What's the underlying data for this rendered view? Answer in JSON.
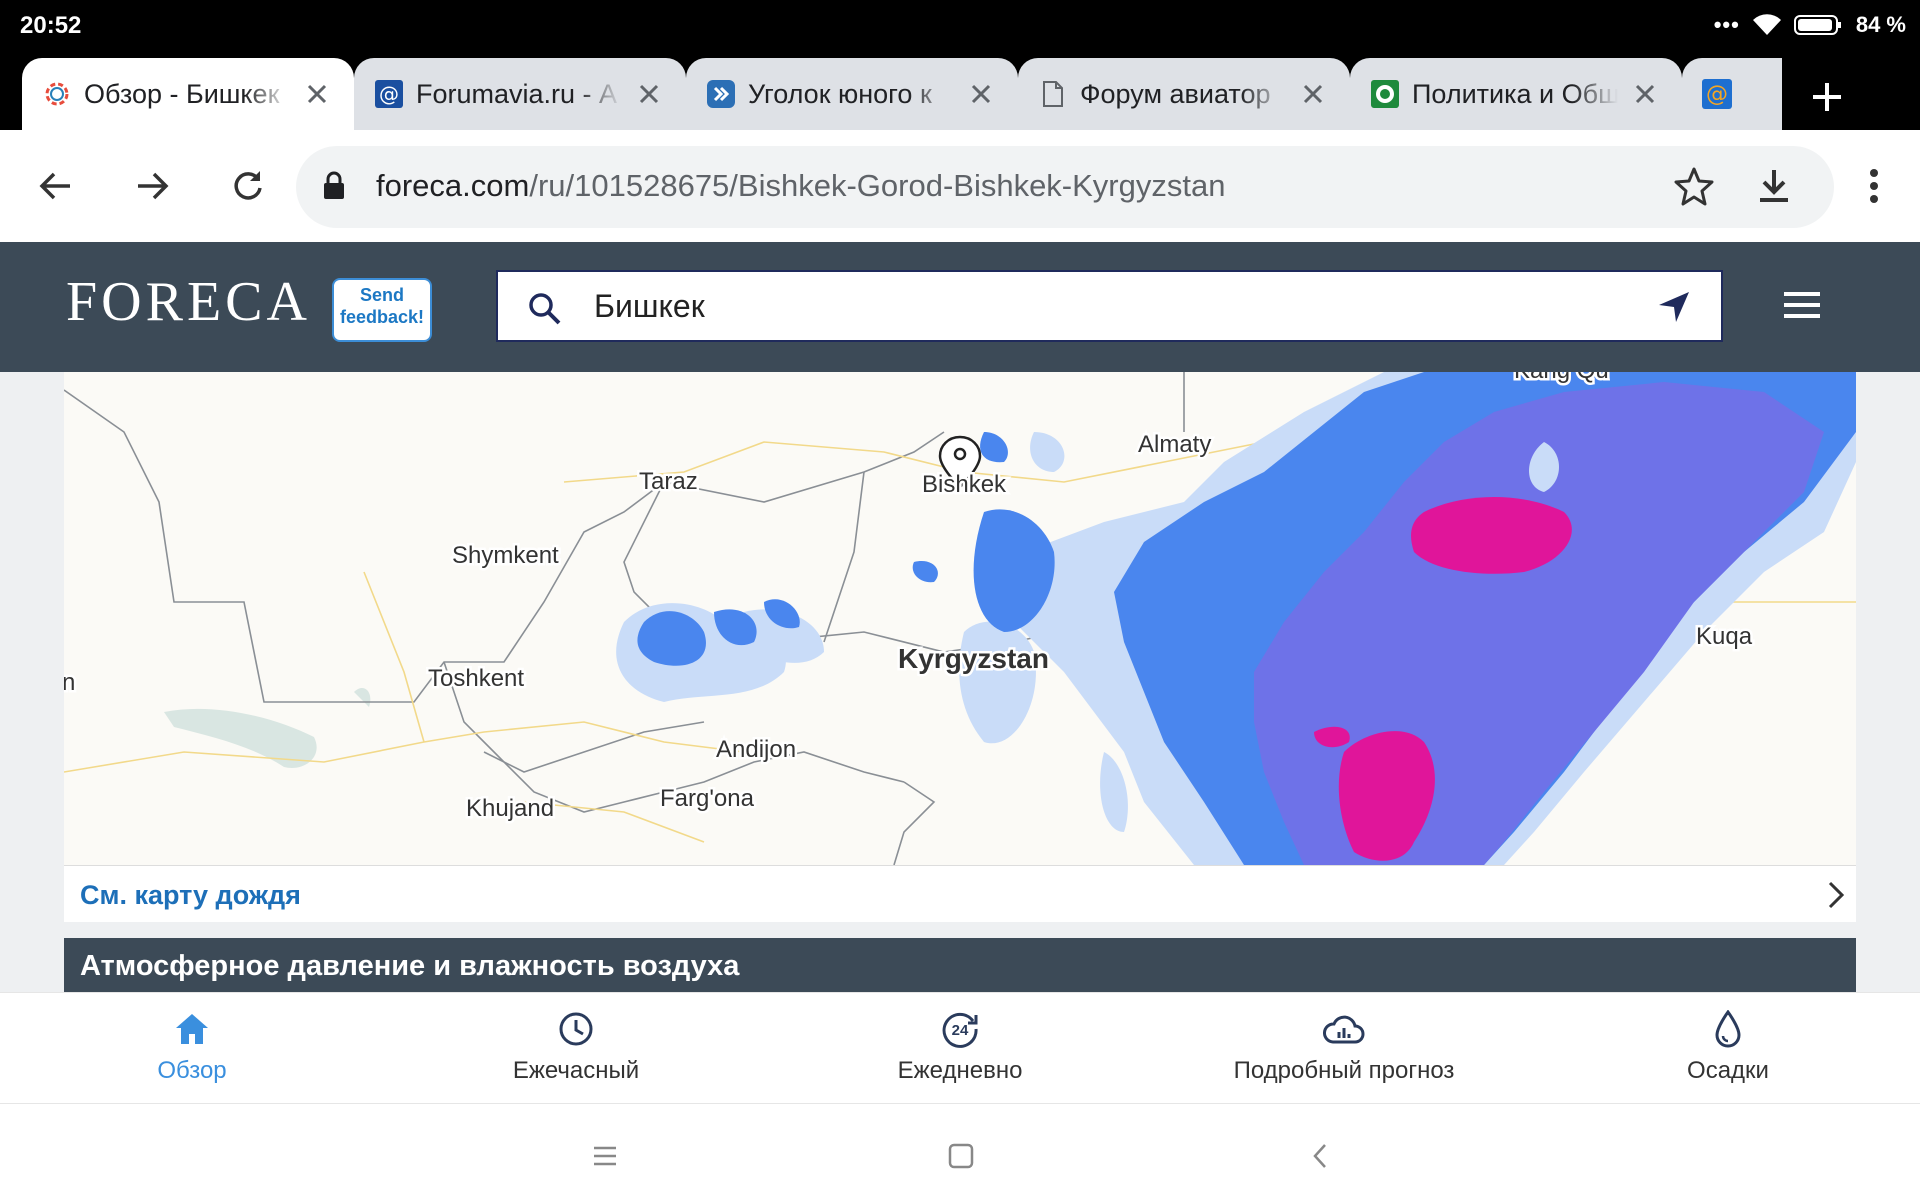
{
  "status": {
    "time": "20:52",
    "battery": "84 %"
  },
  "tabs": [
    {
      "title": "Обзор - Бишкек",
      "active": true,
      "icon": "foreca-favicon-icon"
    },
    {
      "title": "Forumavia.ru - А",
      "active": false,
      "icon": "mail-favicon-icon"
    },
    {
      "title": "Уголок юного к",
      "active": false,
      "icon": "forum-favicon-icon"
    },
    {
      "title": "Форум авиатор",
      "active": false,
      "icon": "document-icon"
    },
    {
      "title": "Политика и Общ",
      "active": false,
      "icon": "green-favicon-icon"
    },
    {
      "title": "",
      "active": false,
      "icon": "mail-favicon-icon"
    }
  ],
  "address": {
    "host": "foreca.com",
    "path": "/ru/101528675/Bishkek-Gorod-Bishkek-Kyrgyzstan"
  },
  "site": {
    "logo": "FORECA",
    "feedback_line1": "Send",
    "feedback_line2": "feedback!",
    "search_value": "Бишкек"
  },
  "map": {
    "labels": {
      "taraz": "Taraz",
      "bishkek": "Bishkek",
      "almaty": "Almaty",
      "shymkent": "Shymkent",
      "toshkent": "Toshkent",
      "kyrgyzstan": "Kyrgyzstan",
      "andijon": "Andijon",
      "fargona": "Farg'ona",
      "khujand": "Khujand",
      "kuqa": "Kuqa",
      "edge_n": "n",
      "top_cut": "Kang Qu"
    },
    "link_text": "См. карту дождя"
  },
  "sections": {
    "pressure_title": "Атмосферное давление и влажность воздуха"
  },
  "bottom_nav": [
    {
      "label": "Обзор",
      "icon": "home-icon",
      "active": true
    },
    {
      "label": "Ежечасный",
      "icon": "clock-icon",
      "active": false
    },
    {
      "label": "Ежедневно",
      "icon": "24h-icon",
      "active": false
    },
    {
      "label": "Подробный прогноз",
      "icon": "cloud-chart-icon",
      "active": false
    },
    {
      "label": "Осадки",
      "icon": "drop-icon",
      "active": false
    }
  ]
}
